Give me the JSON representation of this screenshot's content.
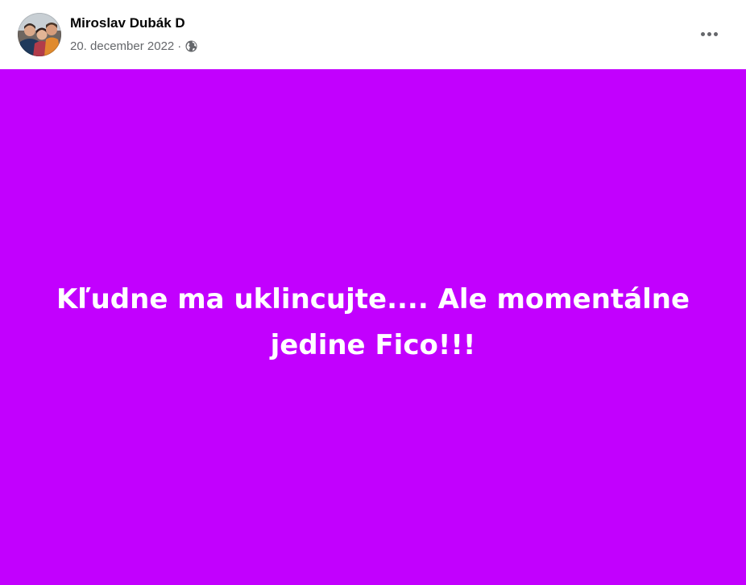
{
  "post": {
    "author": {
      "name": "Miroslav Dubák D",
      "avatar_icon": "profile-photo-avatar"
    },
    "date": "20. december 2022",
    "separator": "·",
    "privacy_icon": "globe-icon",
    "more_icon": "more-options-icon",
    "body": {
      "text": "Kľudne ma uklincujte.... Ale momentálne jedine Fico!!!",
      "background_color": "#c200fe",
      "text_color": "#ffffff"
    }
  }
}
